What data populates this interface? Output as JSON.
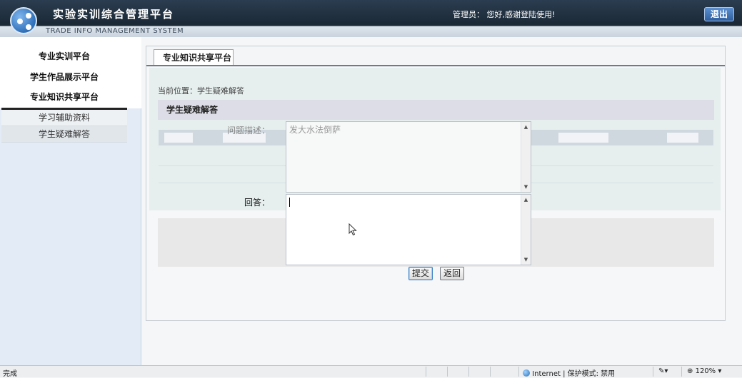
{
  "header": {
    "app_title": "实验实训综合管理平台",
    "app_subtitle": "TRADE INFO MANAGEMENT SYSTEM",
    "greeting": "管理员：  您好,感谢登陆使用!",
    "exit_label": "退出"
  },
  "sidebar": {
    "items": [
      {
        "label": "专业实训平台"
      },
      {
        "label": "学生作品展示平台"
      },
      {
        "label": "专业知识共享平台"
      }
    ],
    "submenu": [
      {
        "label": "学习辅助资料"
      },
      {
        "label": "学生疑难解答"
      }
    ]
  },
  "main": {
    "tab_label": "专业知识共享平台",
    "breadcrumb": "当前位置：学生疑难解答",
    "section_title": "学生疑难解答"
  },
  "form": {
    "description_label": "问题描述：",
    "description_value": "发大水法倒萨",
    "answer_label": "回答：",
    "answer_value": "",
    "submit_label": "提交",
    "back_label": "返回"
  },
  "statusbar": {
    "left": "完成",
    "zone": "Internet | 保护模式: 禁用",
    "zoom": "120%"
  },
  "colors": {
    "header_dark": "#1c2a38",
    "sidebar_bg": "#e3ecf6",
    "section_bar": "#dcdde6",
    "exit_button": "#2f5f9e"
  }
}
